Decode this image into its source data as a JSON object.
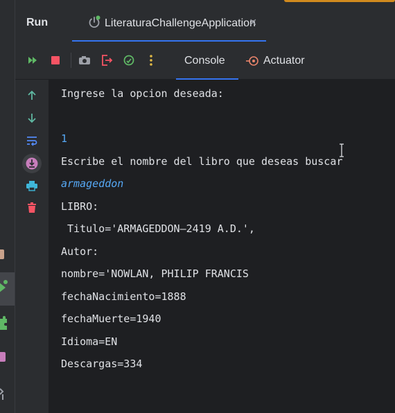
{
  "window": {
    "panel_title": "Run",
    "tab_label": "LiteraturaChallengeApplication"
  },
  "toolbar": {
    "subtabs": [
      {
        "label": "Console",
        "active": true
      },
      {
        "label": "Actuator",
        "active": false
      }
    ]
  },
  "console": {
    "lines": [
      {
        "text": "Ingrese la opcion deseada:",
        "kind": "output"
      },
      {
        "text": "",
        "kind": "output"
      },
      {
        "text": "1",
        "kind": "input"
      },
      {
        "text": "Escribe el nombre del libro que deseas buscar",
        "kind": "output"
      },
      {
        "text": "armageddon",
        "kind": "input"
      },
      {
        "text": "LIBRO:",
        "kind": "output"
      },
      {
        "text": " Titulo='ARMAGEDDON—2419 A.D.',",
        "kind": "output"
      },
      {
        "text": "Autor:",
        "kind": "output"
      },
      {
        "text": "nombre='NOWLAN, PHILIP FRANCIS",
        "kind": "output"
      },
      {
        "text": "fechaNacimiento=1888",
        "kind": "output"
      },
      {
        "text": "fechaMuerte=1940",
        "kind": "output"
      },
      {
        "text": "Idioma=EN",
        "kind": "output"
      },
      {
        "text": "Descargas=334",
        "kind": "output"
      }
    ]
  },
  "colors": {
    "accent": "#3574f0",
    "run_green": "#5fb865",
    "stop_red": "#f75464",
    "input_blue": "#56a8f5"
  }
}
